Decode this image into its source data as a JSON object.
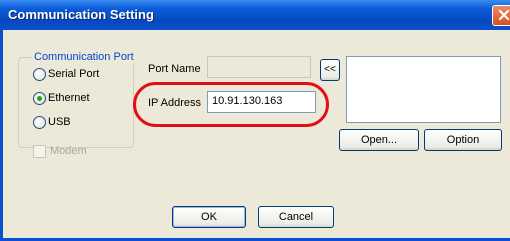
{
  "window": {
    "title": "Communication Setting"
  },
  "comm_port": {
    "legend": "Communication Port",
    "options": [
      {
        "label": "Serial Port",
        "selected": false
      },
      {
        "label": "Ethernet",
        "selected": true
      },
      {
        "label": "USB",
        "selected": false
      }
    ],
    "modem_label": "Modem"
  },
  "port_name": {
    "label": "Port Name",
    "value": ""
  },
  "ip_address": {
    "label": "IP Address",
    "value": "10.91.130.163"
  },
  "buttons": {
    "collapse": "<<",
    "open": "Open...",
    "option": "Option",
    "ok": "OK",
    "cancel": "Cancel"
  },
  "colors": {
    "title_bar": "#0a5bd8",
    "legend_text": "#0046d5",
    "highlight": "#e0101a"
  }
}
